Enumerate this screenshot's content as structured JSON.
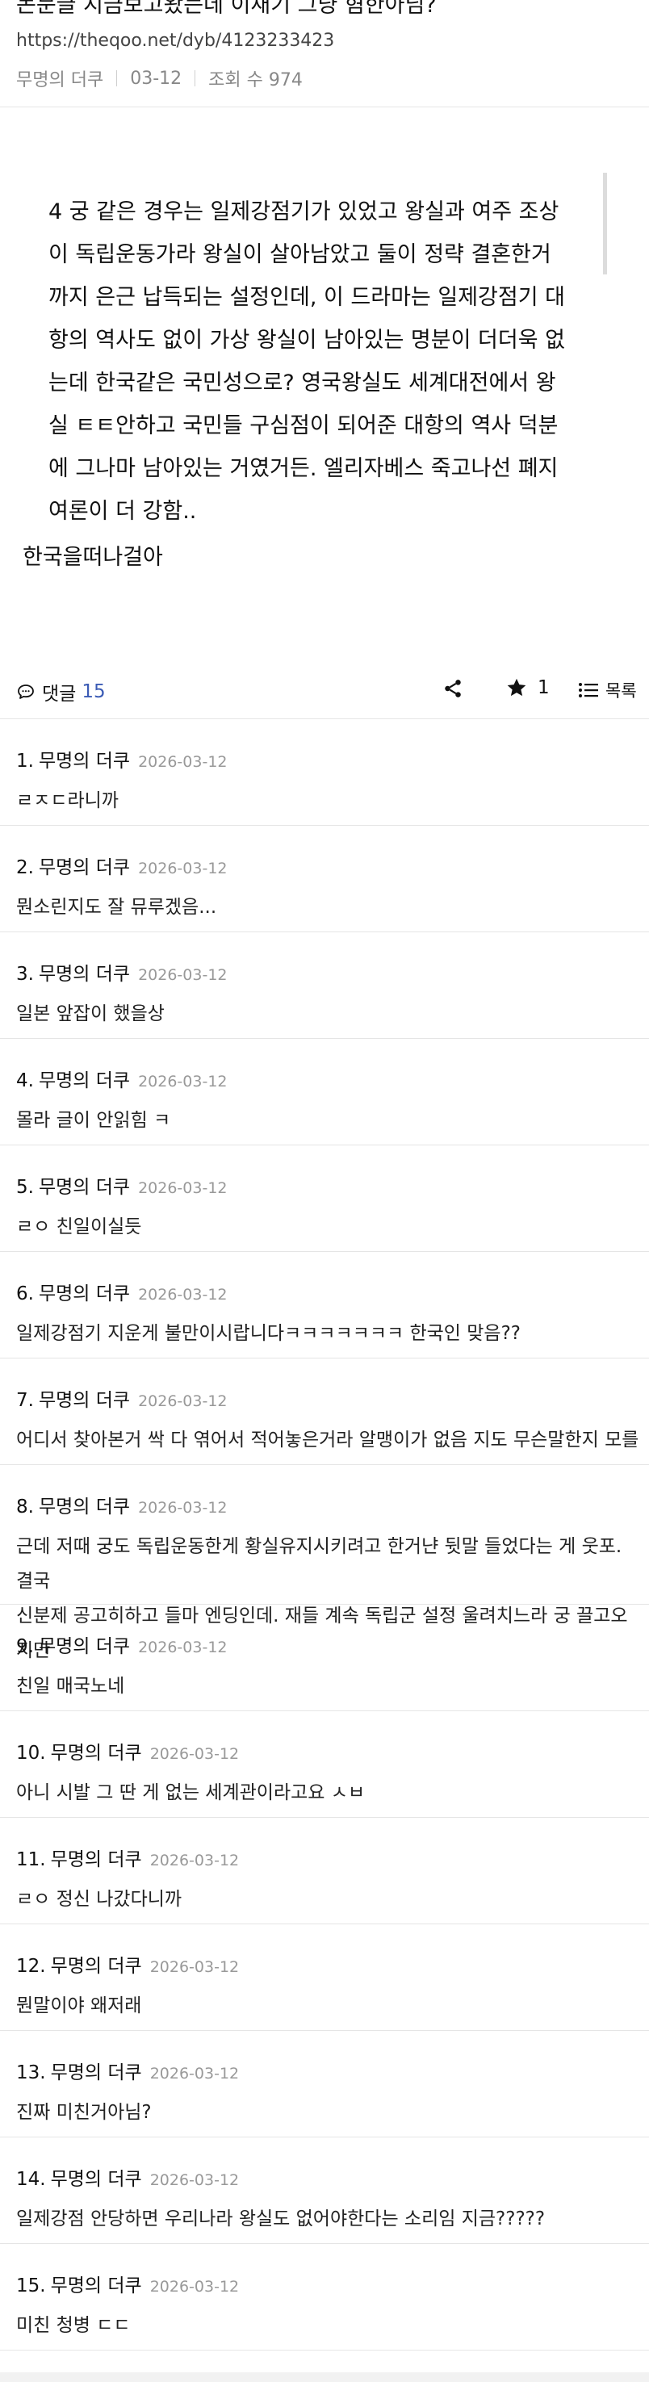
{
  "post": {
    "title": "논문글 지금보고왔는데 이새기 그냥 혐한아님?",
    "url": "https://theqoo.net/dyb/4123233423",
    "author": "무명의 더쿠",
    "date": "03-12",
    "views": "조회 수 974"
  },
  "quote": {
    "text": "4 궁 같은 경우는 일제강점기가 있었고 왕실과 여주 조상\n이 독립운동가라 왕실이 살아남았고 둘이 정략 결혼한거\n까지 은근 납득되는 설정인데, 이 드라마는 일제강점기 대\n항의 역사도 없이 가상 왕실이 남아있는 명분이 더더욱 없\n는데 한국같은 국민성으로? 영국왕실도 세계대전에서 왕\n실 ㅌㅌ안하고 국민들 구심점이 되어준 대항의 역사 덕분\n에 그나마 남아있는 거였거든. 엘리자베스 죽고나선 폐지\n여론이 더 강함.."
  },
  "body_line": "한국을떠나걸아",
  "comment_bar": {
    "label": "댓글",
    "count": "15",
    "star_count": "1",
    "list_label": "목록"
  },
  "comments": [
    {
      "num": "1.",
      "author": "무명의 더쿠",
      "date": "2026-03-12",
      "text": "ㄹㅈㄷ라니까"
    },
    {
      "num": "2.",
      "author": "무명의 더쿠",
      "date": "2026-03-12",
      "text": "뭔소린지도 잘 뮤루겠음..."
    },
    {
      "num": "3.",
      "author": "무명의 더쿠",
      "date": "2026-03-12",
      "text": "일본 앞잡이 했을상"
    },
    {
      "num": "4.",
      "author": "무명의 더쿠",
      "date": "2026-03-12",
      "text": "몰라 글이 안읽힘 ㅋ"
    },
    {
      "num": "5.",
      "author": "무명의 더쿠",
      "date": "2026-03-12",
      "text": "ㄹㅇ 친일이실듯"
    },
    {
      "num": "6.",
      "author": "무명의 더쿠",
      "date": "2026-03-12",
      "text": "일제강점기 지운게 불만이시랍니다ㅋㅋㅋㅋㅋㅋㅋ 한국인 맞음??"
    },
    {
      "num": "7.",
      "author": "무명의 더쿠",
      "date": "2026-03-12",
      "text": "어디서 찾아본거 싹 다 엮어서 적어놓은거라 알맹이가 없음 지도 무슨말한지 모를걸"
    },
    {
      "num": "8.",
      "author": "무명의 더쿠",
      "date": "2026-03-12",
      "text": "근데 저때 궁도 독립운동한게 황실유지시키려고 한거냔 뒷말 들었다는 게 웃포. 결국\n신분제 공고히하고 들마 엔딩인데. 재들 계속 독립군 설정 울려치느라 궁 끌고오지만"
    },
    {
      "num": "9.",
      "author": "무명의 더쿠",
      "date": "2026-03-12",
      "text": "친일 매국노네"
    },
    {
      "num": "10.",
      "author": "무명의 더쿠",
      "date": "2026-03-12",
      "text": "아니 시발 그 딴 게 없는 세계관이라고요 ㅅㅂ"
    },
    {
      "num": "11.",
      "author": "무명의 더쿠",
      "date": "2026-03-12",
      "text": "ㄹㅇ 정신 나갔다니까"
    },
    {
      "num": "12.",
      "author": "무명의 더쿠",
      "date": "2026-03-12",
      "text": "뭔말이야 왜저래"
    },
    {
      "num": "13.",
      "author": "무명의 더쿠",
      "date": "2026-03-12",
      "text": "진짜 미친거아님?"
    },
    {
      "num": "14.",
      "author": "무명의 더쿠",
      "date": "2026-03-12",
      "text": "일제강점 안당하면 우리나라 왕실도 없어야한다는 소리임 지금?????"
    },
    {
      "num": "15.",
      "author": "무명의 더쿠",
      "date": "2026-03-12",
      "text": "미친 청병 ㄷㄷ"
    }
  ],
  "icons": {
    "comment": "comment-bubble-icon",
    "share": "share-icon",
    "star": "star-icon",
    "list": "list-icon"
  },
  "colors": {
    "accent": "#3b5bb5",
    "muted": "#999999",
    "divider": "#e5e5e5"
  }
}
